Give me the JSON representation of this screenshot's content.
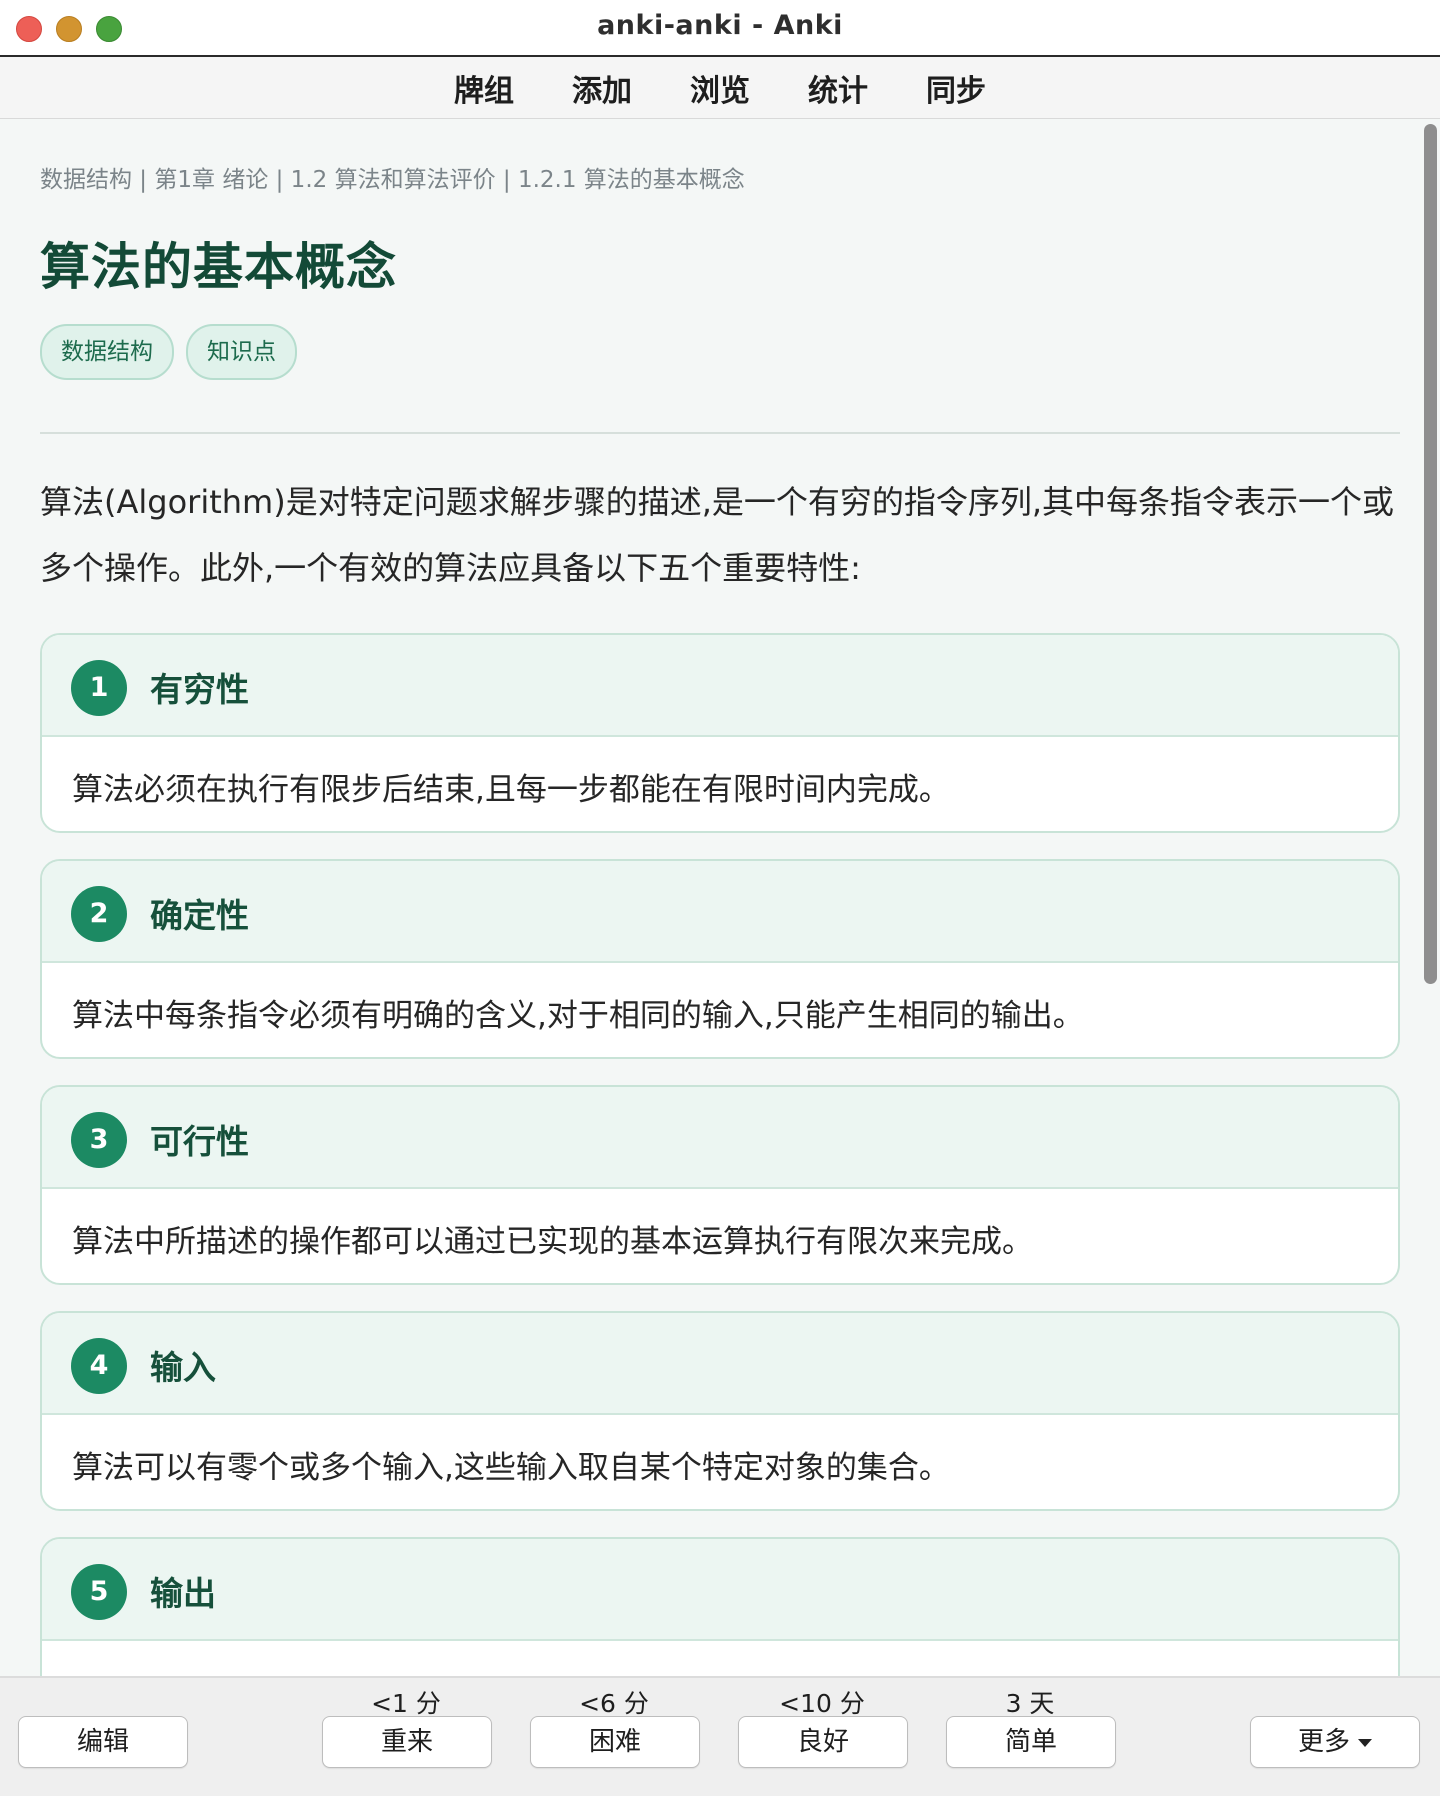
{
  "window": {
    "title": "anki-anki - Anki"
  },
  "toolbar": {
    "items": [
      {
        "label": "牌组"
      },
      {
        "label": "添加"
      },
      {
        "label": "浏览"
      },
      {
        "label": "统计"
      },
      {
        "label": "同步"
      }
    ]
  },
  "card": {
    "breadcrumb": "数据结构 | 第1章 绪论 | 1.2 算法和算法评价 | 1.2.1 算法的基本概念",
    "title": "算法的基本概念",
    "tags": [
      "数据结构",
      "知识点"
    ],
    "intro": "算法(Algorithm)是对特定问题求解步骤的描述,是一个有穷的指令序列,其中每条指令表示一个或多个操作。此外,一个有效的算法应具备以下五个重要特性:",
    "properties": [
      {
        "num": "1",
        "title": "有穷性",
        "desc": "算法必须在执行有限步后结束,且每一步都能在有限时间内完成。"
      },
      {
        "num": "2",
        "title": "确定性",
        "desc": "算法中每条指令必须有明确的含义,对于相同的输入,只能产生相同的输出。"
      },
      {
        "num": "3",
        "title": "可行性",
        "desc": "算法中所描述的操作都可以通过已实现的基本运算执行有限次来完成。"
      },
      {
        "num": "4",
        "title": "输入",
        "desc": "算法可以有零个或多个输入,这些输入取自某个特定对象的集合。"
      },
      {
        "num": "5",
        "title": "输出",
        "desc": ""
      }
    ]
  },
  "bottombar": {
    "edit_label": "编辑",
    "more_label": "更多",
    "answers": [
      {
        "interval": "<1 分",
        "label": "重来"
      },
      {
        "interval": "<6 分",
        "label": "困难"
      },
      {
        "interval": "<10 分",
        "label": "良好"
      },
      {
        "interval": "3 天",
        "label": "简单"
      }
    ]
  },
  "colors": {
    "accent": "#1c8a63",
    "title": "#134a37",
    "tag_bg": "#e0f2eb"
  }
}
